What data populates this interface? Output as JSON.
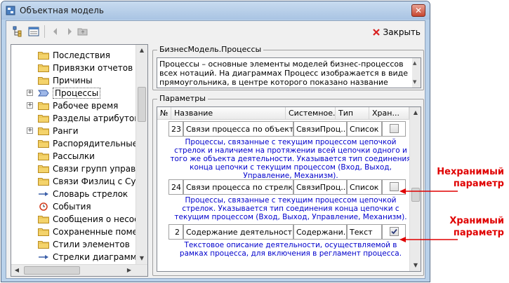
{
  "window": {
    "title": "Объектная модель"
  },
  "toolbar": {
    "close_label": "Закрыть"
  },
  "tree": {
    "items": [
      {
        "label": "Последствия",
        "expandable": false
      },
      {
        "label": "Привязки отчетов",
        "expandable": false
      },
      {
        "label": "Причины",
        "expandable": false
      },
      {
        "label": "Процессы",
        "expandable": true
      },
      {
        "label": "Рабочее время",
        "expandable": true
      },
      {
        "label": "Разделы атрибутов об",
        "expandable": false
      },
      {
        "label": "Ранги",
        "expandable": true
      },
      {
        "label": "Распорядительные до",
        "expandable": false
      },
      {
        "label": "Рассылки",
        "expandable": false
      },
      {
        "label": "Связи групп управлен",
        "expandable": false
      },
      {
        "label": "Связи Физлиц с Субъ",
        "expandable": false
      },
      {
        "label": "Словарь стрелок",
        "expandable": false
      },
      {
        "label": "События",
        "expandable": false
      },
      {
        "label": "Сообщения о несоот",
        "expandable": false
      },
      {
        "label": "Сохраненные пометк",
        "expandable": false
      },
      {
        "label": "Стили элементов",
        "expandable": false
      },
      {
        "label": "Стрелки диаграмм",
        "expandable": false
      }
    ]
  },
  "description": {
    "title": "БизнесМодель.Процессы",
    "text": "Процессы – основные элементы моделей бизнес-процессов всех нотаций. На диаграммах Процесс изображается в виде прямоугольника, в центре которого показано название Процесса."
  },
  "params": {
    "title": "Параметры",
    "columns": [
      "№",
      "Название",
      "Системное...",
      "Тип",
      "Хран..."
    ],
    "rows": [
      {
        "num": "23",
        "name": "Связи процесса по объектам",
        "sys": "СвязиПроц...",
        "type": "Список",
        "stored": false,
        "desc": "Процессы, связанные с текущим процессом цепочкой стрелок и наличием на протяжении всей цепочки одного и того же объекта деятельности. Указывается тип соединения конца цепочки с текущим процессом (Вход, Выход, Управление, Механизм)."
      },
      {
        "num": "24",
        "name": "Связи процесса по стрелкам",
        "sys": "СвязиПроц...",
        "type": "Список",
        "stored": false,
        "desc": "Процессы, связанные с текущим процессом цепочкой стрелок. Указывается тип соединения конца цепочки с текущим процессом (Вход, Выход, Управление, Механизм)."
      },
      {
        "num": "2",
        "name": "Содержание деятельности",
        "sys": "Содержани...",
        "type": "Текст",
        "stored": true,
        "desc": "Текстовое описание деятельности, осуществляемой в рамках процесса, для включения в регламент процесса."
      }
    ]
  },
  "annotations": {
    "nonstored": "Нехранимый параметр",
    "stored": "Хранимый параметр"
  },
  "colors": {
    "annotation": "#e00000",
    "description_text": "#0000cc",
    "window_frame": "#b9d1ea"
  }
}
